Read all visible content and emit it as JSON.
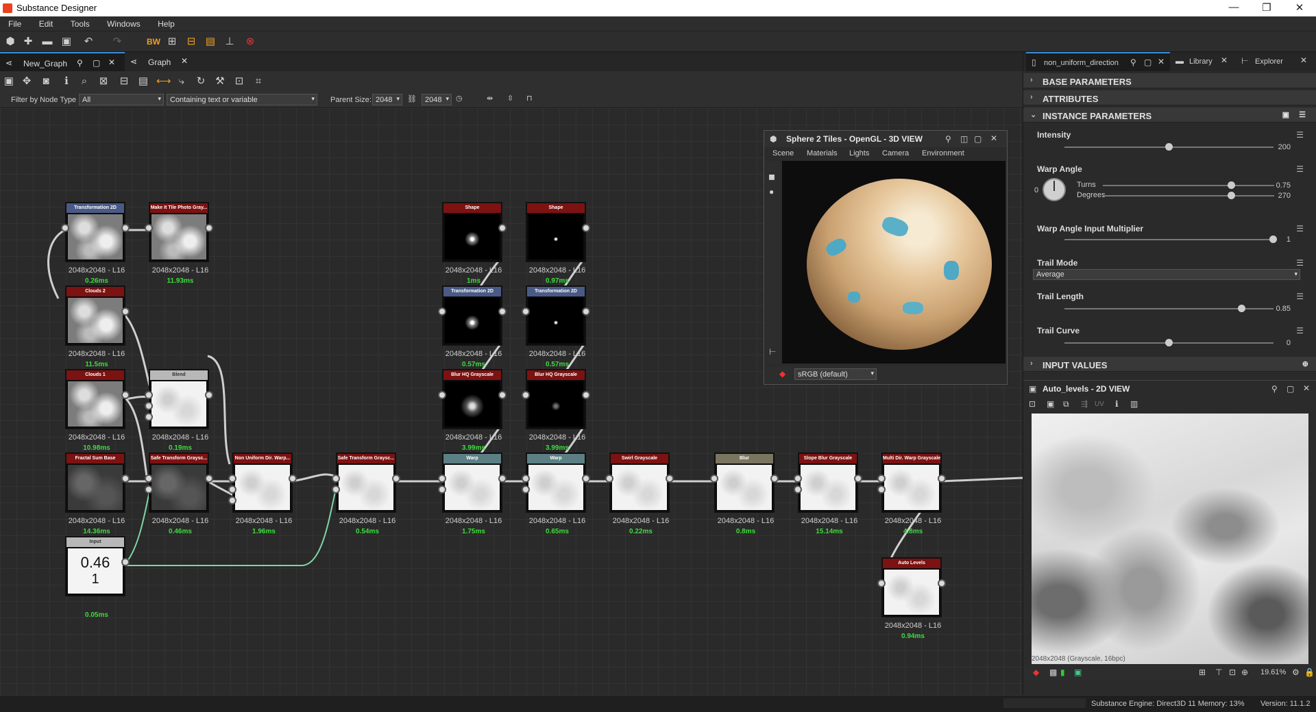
{
  "app": {
    "title": "Substance Designer"
  },
  "window_controls": {
    "minimize": "—",
    "maximize": "❐",
    "close": "✕"
  },
  "menu": [
    "File",
    "Edit",
    "Tools",
    "Windows",
    "Help"
  ],
  "tabs": [
    {
      "label": "New_Graph"
    },
    {
      "label": "Graph"
    }
  ],
  "filter": {
    "label": "Filter by Node Type",
    "type_value": "All",
    "text_placeholder": "Containing text or variable",
    "parent_label": "Parent Size:",
    "parent_w": "2048",
    "parent_h": "2048"
  },
  "nodes": [
    {
      "title": "Transformation 2D",
      "size": "2048x2048 - L16",
      "time": "0.26ms"
    },
    {
      "title": "Make It Tile Photo Gray...",
      "size": "2048x2048 - L16",
      "time": "11.93ms"
    },
    {
      "title": "Clouds 2",
      "size": "2048x2048 - L16",
      "time": "11.5ms"
    },
    {
      "title": "Blend",
      "size": "2048x2048 - L16",
      "time": "0.19ms"
    },
    {
      "title": "Clouds 1",
      "size": "2048x2048 - L16",
      "time": "10.98ms"
    },
    {
      "title": "Fractal Sum Base",
      "size": "2048x2048 - L16",
      "time": "14.36ms"
    },
    {
      "title": "Safe Transform Graysc...",
      "size": "2048x2048 - L16",
      "time": "0.46ms"
    },
    {
      "title": "Non Uniform Dir. Warp...",
      "size": "2048x2048 - L16",
      "time": "1.96ms"
    },
    {
      "title": "Safe Transform Graysc...",
      "size": "2048x2048 - L16",
      "time": "0.54ms"
    },
    {
      "title": "Shape",
      "size": "2048x2048 - L16",
      "time": "1ms"
    },
    {
      "title": "Shape",
      "size": "2048x2048 - L16",
      "time": "0.97ms"
    },
    {
      "title": "Transformation 2D",
      "size": "2048x2048 - L16",
      "time": "0.57ms"
    },
    {
      "title": "Transformation 2D",
      "size": "2048x2048 - L16",
      "time": "0.57ms"
    },
    {
      "title": "Blur HQ Grayscale",
      "size": "2048x2048 - L16",
      "time": "3.99ms"
    },
    {
      "title": "Blur HQ Grayscale",
      "size": "2048x2048 - L16",
      "time": "3.99ms"
    },
    {
      "title": "Warp",
      "size": "2048x2048 - L16",
      "time": "1.75ms"
    },
    {
      "title": "Warp",
      "size": "2048x2048 - L16",
      "time": "0.65ms"
    },
    {
      "title": "Swirl Grayscale",
      "size": "2048x2048 - L16",
      "time": "0.22ms"
    },
    {
      "title": "Blur",
      "size": "2048x2048 - L16",
      "time": "0.8ms"
    },
    {
      "title": "Slope Blur Grayscale",
      "size": "2048x2048 - L16",
      "time": "15.14ms"
    },
    {
      "title": "Multi Dir. Warp Grayscale",
      "size": "2048x2048 - L16",
      "time": "4.8ms"
    },
    {
      "title": "Auto Levels",
      "size": "2048x2048 - L16",
      "time": "0.94ms"
    },
    {
      "title": "Input",
      "size": "",
      "time": "0.05ms",
      "v1": "0.46",
      "v2": "1"
    }
  ],
  "viewer3d": {
    "title": "Sphere 2 Tiles - OpenGL - 3D VIEW",
    "menu": [
      "Scene",
      "Materials",
      "Lights",
      "Camera",
      "Environment"
    ],
    "colorspace": "sRGB (default)"
  },
  "right_tabs": [
    {
      "label": "non_uniform_direction..."
    },
    {
      "label": "Library"
    },
    {
      "label": "Explorer"
    }
  ],
  "sections": {
    "base": "BASE PARAMETERS",
    "attributes": "ATTRIBUTES",
    "instance": "INSTANCE PARAMETERS",
    "input_values": "INPUT VALUES"
  },
  "params": {
    "intensity": {
      "label": "Intensity",
      "value": "200"
    },
    "warp_angle": {
      "label": "Warp Angle",
      "angle": "0",
      "turns_label": "Turns",
      "turns": "0.75",
      "degrees_label": "Degrees",
      "degrees": "270"
    },
    "multiplier": {
      "label": "Warp Angle Input Multiplier",
      "value": "1"
    },
    "trail_mode": {
      "label": "Trail Mode",
      "value": "Average"
    },
    "trail_length": {
      "label": "Trail Length",
      "value": "0.85"
    },
    "trail_curve": {
      "label": "Trail Curve",
      "value": "0"
    }
  },
  "slider_levels": {
    "intensity": 0.5,
    "turns": 0.75,
    "degrees": 0.75,
    "multiplier": 1.0,
    "trail_length": 0.85,
    "trail_curve": 0.5
  },
  "viewer2d": {
    "title": "Auto_levels - 2D VIEW",
    "uv": "UV",
    "overlay": "2048x2048 (Grayscale, 16bpc)",
    "zoom": "19.61%"
  },
  "status": {
    "engine": "Substance Engine: Direct3D 11  Memory: 13%",
    "version": "Version: 11.1.2"
  }
}
